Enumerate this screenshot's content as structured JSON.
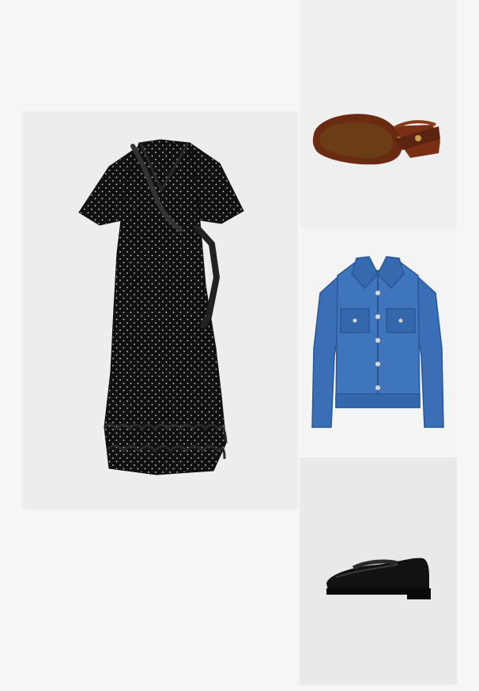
{
  "colors": {
    "page_background": "#f6f6f6",
    "dress_tile": "#ededed",
    "sunglasses_tile": "#efefef",
    "jacket_tile": "#f4f4f4",
    "loafer_tile": "#e9e9e9",
    "dress": "#111111",
    "dot": "#d8d8d8",
    "sunglasses_frame": "#6b2a12",
    "sunglasses_lens": "#6a3d16",
    "denim": "#3a6fb6",
    "denim_dark": "#2a5796",
    "loafer": "#121212"
  },
  "items": [
    {
      "key": "dress",
      "icon": "polka-dot-wrap-dress"
    },
    {
      "key": "sunglasses",
      "icon": "oval-sunglasses"
    },
    {
      "key": "jacket",
      "icon": "denim-jacket"
    },
    {
      "key": "loafer",
      "icon": "black-loafer"
    }
  ]
}
